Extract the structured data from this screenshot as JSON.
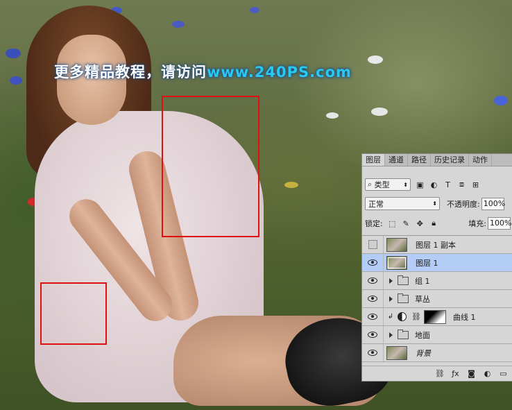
{
  "watermark": {
    "text": "更多精品教程，请访问",
    "url": "www.240PS.com"
  },
  "panel": {
    "tabs": [
      "图层",
      "通道",
      "路径",
      "历史记录",
      "动作"
    ],
    "filter": {
      "label": "类型"
    },
    "filter_icons": [
      "image-filter-icon",
      "adjustment-filter-icon",
      "type-filter-icon",
      "shape-filter-icon",
      "smart-object-filter-icon"
    ],
    "blend_mode": "正常",
    "opacity_label": "不透明度:",
    "opacity_value": "100%",
    "lock_label": "锁定:",
    "fill_label": "填充:",
    "fill_value": "100%",
    "layers": [
      {
        "name": "图层 1 副本",
        "visible": false,
        "kind": "pixel"
      },
      {
        "name": "图层 1",
        "visible": true,
        "kind": "pixel",
        "selected": true
      },
      {
        "name": "组 1",
        "visible": true,
        "kind": "group"
      },
      {
        "name": "草丛",
        "visible": true,
        "kind": "group"
      },
      {
        "name": "曲线 1",
        "visible": true,
        "kind": "adjustment"
      },
      {
        "name": "地面",
        "visible": true,
        "kind": "group"
      },
      {
        "name": "背景",
        "visible": true,
        "kind": "background"
      }
    ]
  },
  "colors": {
    "selection_box": "#e01010",
    "selected_layer": "#b3cdf7",
    "url": "#28c8f0"
  }
}
